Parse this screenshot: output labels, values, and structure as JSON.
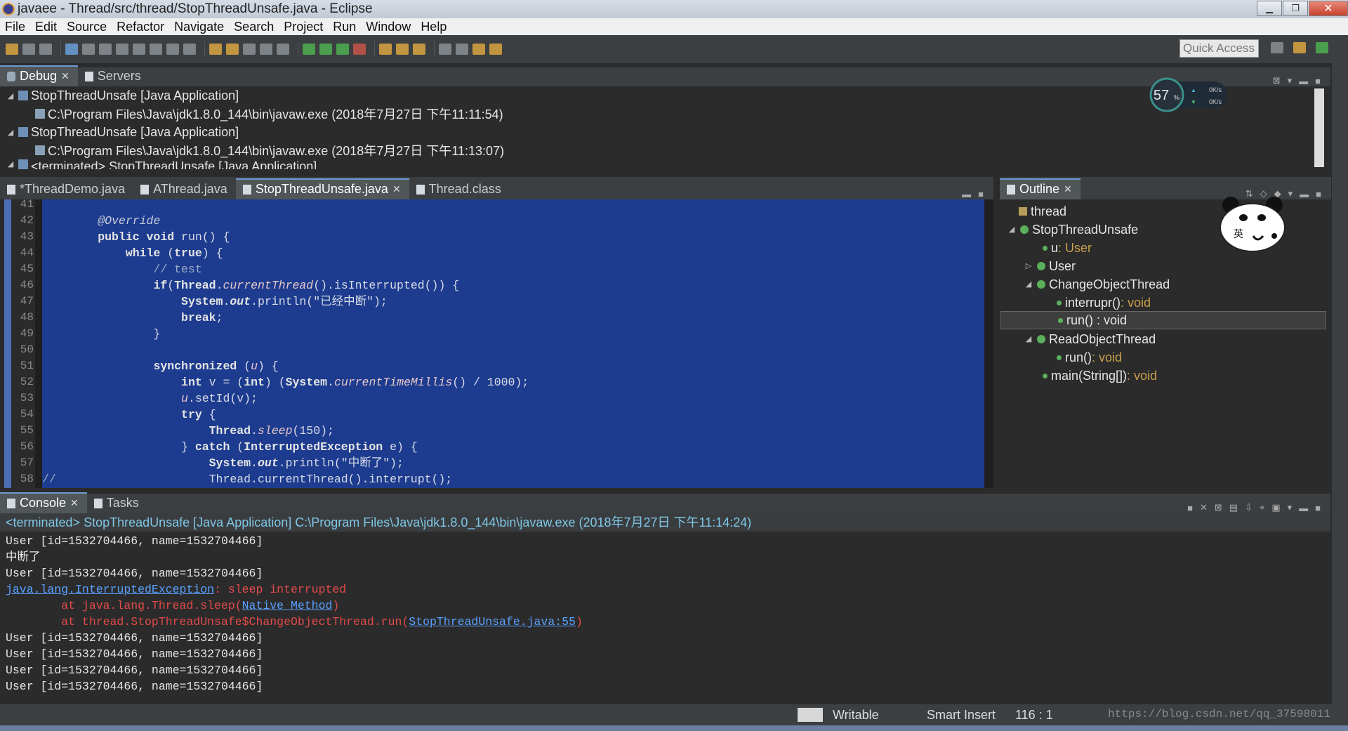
{
  "window": {
    "title": "javaee - Thread/src/thread/StopThreadUnsafe.java - Eclipse"
  },
  "menu": [
    "File",
    "Edit",
    "Source",
    "Refactor",
    "Navigate",
    "Search",
    "Project",
    "Run",
    "Window",
    "Help"
  ],
  "quick_access": "Quick Access",
  "debug_panel": {
    "tabs": [
      {
        "label": "Debug"
      },
      {
        "label": "Servers"
      }
    ],
    "rows": [
      {
        "text": "StopThreadUnsafe [Java Application]"
      },
      {
        "text": "C:\\Program Files\\Java\\jdk1.8.0_144\\bin\\javaw.exe (2018年7月27日 下午11:11:54)"
      },
      {
        "text": "StopThreadUnsafe [Java Application]"
      },
      {
        "text": "C:\\Program Files\\Java\\jdk1.8.0_144\\bin\\javaw.exe (2018年7月27日 下午11:13:07)"
      },
      {
        "text": "<terminated> StopThreadUnsafe [Java Application]"
      }
    ]
  },
  "net_widget": {
    "percent": "57",
    "unit": "%",
    "up": "0K/s",
    "down": "0K/s"
  },
  "editor": {
    "tabs": [
      {
        "label": "*ThreadDemo.java"
      },
      {
        "label": "AThread.java"
      },
      {
        "label": "StopThreadUnsafe.java"
      },
      {
        "label": "Thread.class"
      }
    ],
    "line_numbers": [
      "41",
      "42",
      "43",
      "44",
      "45",
      "46",
      "47",
      "48",
      "49",
      "50",
      "51",
      "52",
      "53",
      "54",
      "55",
      "56",
      "57",
      "58"
    ]
  },
  "outline": {
    "tab": "Outline",
    "items": [
      {
        "name": "thread",
        "type": ""
      },
      {
        "name": "StopThreadUnsafe",
        "type": ""
      },
      {
        "name": "u",
        "type": " : User"
      },
      {
        "name": "User",
        "type": ""
      },
      {
        "name": "ChangeObjectThread",
        "type": ""
      },
      {
        "name": "interrupr()",
        "type": " : void"
      },
      {
        "name": "run() : void",
        "type": ""
      },
      {
        "name": "ReadObjectThread",
        "type": ""
      },
      {
        "name": "run()",
        "type": " : void"
      },
      {
        "name": "main(String[])",
        "type": " : void"
      }
    ]
  },
  "console": {
    "tabs": [
      {
        "label": "Console"
      },
      {
        "label": "Tasks"
      }
    ],
    "terminated": "<terminated> StopThreadUnsafe [Java Application] C:\\Program Files\\Java\\jdk1.8.0_144\\bin\\javaw.exe (2018年7月27日 下午11:14:24)",
    "l1": "User [id=1532704466, name=1532704466]",
    "l2": "中断了",
    "l3": "User [id=1532704466, name=1532704466]",
    "exc_link": "java.lang.InterruptedException",
    "exc_msg": ": sleep interrupted",
    "at1_pre": "        at java.lang.Thread.sleep(",
    "at1_link": "Native Method",
    "at1_post": ")",
    "at2_pre": "        at thread.StopThreadUnsafe$ChangeObjectThread.run(",
    "at2_link": "StopThreadUnsafe.java:55",
    "at2_post": ")",
    "l4": "User [id=1532704466, name=1532704466]",
    "l5": "User [id=1532704466, name=1532704466]",
    "l6": "User [id=1532704466, name=1532704466]",
    "l7": "User [id=1532704466, name=1532704466]"
  },
  "status": {
    "writable": "Writable",
    "insert": "Smart Insert",
    "position": "116 : 1",
    "watermark": "https://blog.csdn.net/qq_37598011"
  }
}
